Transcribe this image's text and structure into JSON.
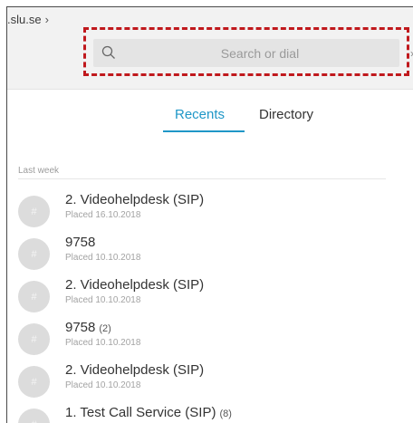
{
  "header": {
    "domain": ".slu.se",
    "domain_chevron": "chevron-right-icon"
  },
  "search": {
    "placeholder": "Search or dial",
    "icon": "search-icon"
  },
  "tabs": [
    {
      "label": "Recents",
      "active": true
    },
    {
      "label": "Directory",
      "active": false
    }
  ],
  "colors": {
    "accent": "#1f97c7",
    "highlight": "#c0191d"
  },
  "recents": {
    "section_label": "Last week",
    "items": [
      {
        "avatar": "#",
        "title": "2. Videohelpdesk (SIP)",
        "count": "",
        "subtitle": "Placed 16.10.2018"
      },
      {
        "avatar": "#",
        "title": "9758",
        "count": "",
        "subtitle": "Placed 10.10.2018"
      },
      {
        "avatar": "#",
        "title": "2. Videohelpdesk (SIP)",
        "count": "",
        "subtitle": "Placed 10.10.2018"
      },
      {
        "avatar": "#",
        "title": "9758",
        "count": "(2)",
        "subtitle": "Placed 10.10.2018"
      },
      {
        "avatar": "#",
        "title": "2. Videohelpdesk (SIP)",
        "count": "",
        "subtitle": "Placed 10.10.2018"
      },
      {
        "avatar": "#",
        "title": "1. Test Call Service (SIP)",
        "count": "(8)",
        "subtitle": ""
      }
    ]
  }
}
